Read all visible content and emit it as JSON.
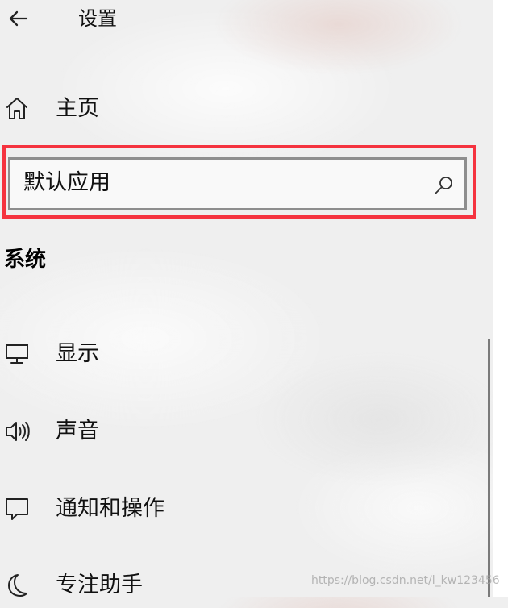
{
  "app": {
    "title": "设置"
  },
  "nav": {
    "home_label": "主页"
  },
  "search": {
    "value": "默认应用",
    "placeholder": "默认应用"
  },
  "section": {
    "title": "系统"
  },
  "menu": {
    "items": [
      {
        "label": "显示",
        "icon": "monitor-icon"
      },
      {
        "label": "声音",
        "icon": "speaker-icon"
      },
      {
        "label": "通知和操作",
        "icon": "notification-icon"
      },
      {
        "label": "专注助手",
        "icon": "moon-icon"
      }
    ]
  },
  "watermark": {
    "text": "https://blog.csdn.net/l_kw123456"
  },
  "colors": {
    "highlight": "#f5333f",
    "search_border": "#8e8e8e",
    "scrollbar": "#7a7a7a"
  }
}
